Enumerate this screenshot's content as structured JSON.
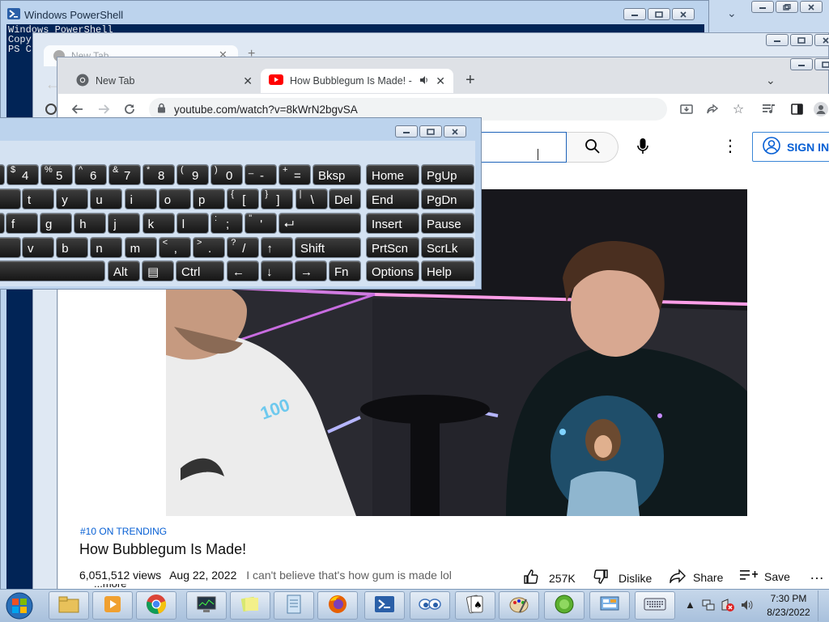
{
  "powershell": {
    "title": "Windows PowerShell",
    "console_lines": [
      "Windows PowerShell",
      "Copyri",
      "",
      "PS C"
    ]
  },
  "chrome_back": {
    "tab_label": "New Tab"
  },
  "chrome": {
    "tabs": [
      {
        "label": "New Tab",
        "icon": "chrome-icon"
      },
      {
        "label": "How Bubblegum Is Made! - ",
        "icon": "youtube-icon",
        "audio": true,
        "active": true
      }
    ],
    "new_tab_symbol": "+",
    "url": "youtube.com/watch?v=8kWrN2bgvSA"
  },
  "youtube": {
    "signin_label": "SIGN IN",
    "trending": "#10 ON TRENDING",
    "video_title": "How Bubblegum Is Made!",
    "views": "6,051,512 views",
    "date": "Aug 22, 2022",
    "description": "I can't believe that's how gum is made lol",
    "more_label": "...more",
    "actions": {
      "likes": "257K",
      "dislike": "Dislike",
      "share": "Share",
      "save": "Save"
    }
  },
  "osk": {
    "rows": [
      [
        {
          "sup": "$",
          "main": "4"
        },
        {
          "sup": "%",
          "main": "5"
        },
        {
          "sup": "^",
          "main": "6"
        },
        {
          "sup": "&",
          "main": "7"
        },
        {
          "sup": "*",
          "main": "8"
        },
        {
          "sup": "(",
          "main": "9"
        },
        {
          "sup": ")",
          "main": "0"
        },
        {
          "sup": "_",
          "main": "-"
        },
        {
          "sup": "+",
          "main": "="
        },
        {
          "main": "Bksp"
        },
        {
          "main": "Home"
        },
        {
          "main": "PgUp"
        }
      ],
      [
        {
          "main": "t"
        },
        {
          "main": "y"
        },
        {
          "main": "u"
        },
        {
          "main": "i"
        },
        {
          "main": "o"
        },
        {
          "main": "p"
        },
        {
          "sup": "{",
          "main": "["
        },
        {
          "sup": "}",
          "main": "]"
        },
        {
          "sup": "|",
          "main": "\\"
        },
        {
          "main": "Del"
        },
        {
          "main": "End"
        },
        {
          "main": "PgDn"
        }
      ],
      [
        {
          "main": "f"
        },
        {
          "main": "g"
        },
        {
          "main": "h"
        },
        {
          "main": "j"
        },
        {
          "main": "k"
        },
        {
          "main": "l"
        },
        {
          "sup": ":",
          "main": ";"
        },
        {
          "sup": "\"",
          "main": "'"
        },
        {
          "main": "⮠"
        },
        {
          "main": "Insert"
        },
        {
          "main": "Pause"
        }
      ],
      [
        {
          "main": "v"
        },
        {
          "main": "b"
        },
        {
          "main": "n"
        },
        {
          "main": "m"
        },
        {
          "sup": "<",
          "main": ","
        },
        {
          "sup": ">",
          "main": "."
        },
        {
          "sup": "?",
          "main": "/"
        },
        {
          "main": "↑"
        },
        {
          "main": "Shift"
        },
        {
          "main": "PrtScn"
        },
        {
          "main": "ScrLk"
        }
      ],
      [
        {
          "main": ""
        },
        {
          "main": "Alt"
        },
        {
          "main": "▤"
        },
        {
          "main": "Ctrl"
        },
        {
          "main": "←"
        },
        {
          "main": "↓"
        },
        {
          "main": "→"
        },
        {
          "main": "Fn"
        },
        {
          "main": "Options"
        },
        {
          "main": "Help"
        }
      ]
    ]
  },
  "taskbar": {
    "time": "7:30 PM",
    "date": "8/23/2022"
  },
  "colors": {
    "youtube_blue": "#065fd4",
    "ps_blue": "#012456",
    "key_dark": "#1e1e1e"
  }
}
